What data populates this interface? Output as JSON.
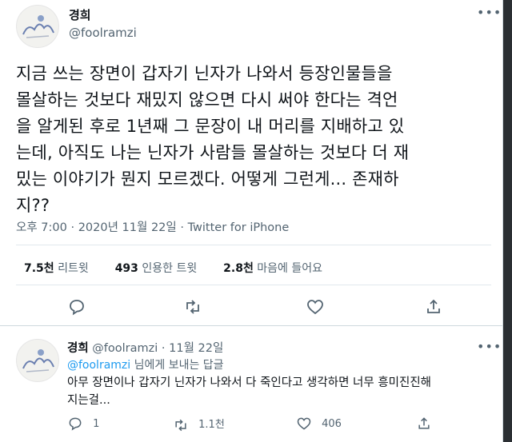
{
  "tweet": {
    "author_name": "경희",
    "author_handle": "@foolramzi",
    "text_lines": [
      "지금 쓰는 장면이 갑자기 닌자가 나와서 등장인물들을",
      "몰살하는 것보다 재밌지 않으면 다시 써야 한다는 격언",
      "을 알게된 후로 1년째 그 문장이 내 머리를 지배하고 있",
      "는데, 아직도 나는 닌자가 사람들 몰살하는 것보다 더 재",
      "밌는 이야기가 뭔지 모르겠다. 어떻게 그런게... 존재하",
      "지??"
    ],
    "time": "오후 7:00",
    "date": "2020년 11월 22일",
    "source": "Twitter for iPhone",
    "retweets_count": "7.5천",
    "retweets_label": "리트윗",
    "quotes_count": "493",
    "quotes_label": "인용한 트윗",
    "likes_count": "2.8천",
    "likes_label": "마음에 들어요"
  },
  "reply": {
    "author_name": "경희",
    "author_handle": "@foolramzi",
    "date": "11월 22일",
    "replying_to": "@foolramzi",
    "replying_suffix": "님에게 보내는 답글",
    "text_lines": [
      "아무 장면이나 갑자기 닌자가 나와서 다 죽인다고 생각하면 너무 흥미진진해",
      "지는걸..."
    ],
    "reply_count": "1",
    "retweet_count": "1.1천",
    "like_count": "406"
  },
  "icons": {
    "more": "more-horizontal-icon",
    "reply": "speech-bubble-icon",
    "retweet": "retweet-arrows-icon",
    "like": "heart-icon",
    "share": "share-upload-icon"
  },
  "colors": {
    "text": "#0f1419",
    "secondary": "#536471",
    "link": "#1d9bf0",
    "divider": "#e1e8ed"
  }
}
